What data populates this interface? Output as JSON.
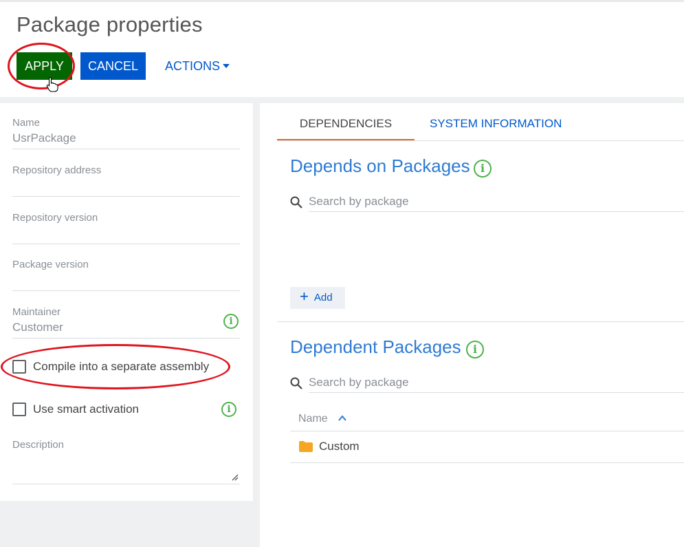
{
  "page": {
    "title": "Package properties"
  },
  "toolbar": {
    "apply_label": "APPLY",
    "cancel_label": "CANCEL",
    "actions_label": "ACTIONS"
  },
  "fields": {
    "name": {
      "label": "Name",
      "value": "UsrPackage"
    },
    "repository_address": {
      "label": "Repository address",
      "value": ""
    },
    "repository_version": {
      "label": "Repository version",
      "value": ""
    },
    "package_version": {
      "label": "Package version",
      "value": ""
    },
    "maintainer": {
      "label": "Maintainer",
      "value": "Customer"
    },
    "compile_separate": {
      "label": "Compile into a separate assembly",
      "checked": false
    },
    "smart_activation": {
      "label": "Use smart activation",
      "checked": false
    },
    "description": {
      "label": "Description",
      "value": ""
    }
  },
  "tabs": [
    {
      "label": "DEPENDENCIES",
      "active": true
    },
    {
      "label": "SYSTEM INFORMATION",
      "active": false
    }
  ],
  "depends_on": {
    "title": "Depends on Packages",
    "search_placeholder": "Search by package",
    "add_label": "Add"
  },
  "dependent": {
    "title": "Dependent Packages",
    "search_placeholder": "Search by package",
    "column_name": "Name",
    "rows": [
      {
        "name": "Custom"
      }
    ]
  },
  "colors": {
    "apply": "#036602",
    "primary": "#0058cc",
    "link": "#2f7bd2",
    "info_icon": "#4db24a",
    "highlight_ring": "#e0141e",
    "tab_underline": "#e06a2c",
    "folder": "#f5a623"
  },
  "icons": [
    "info-icon",
    "search-icon",
    "plus-icon",
    "folder-icon",
    "sort-up-icon",
    "caret-down-icon",
    "hand-cursor-icon",
    "resize-grip-icon"
  ]
}
